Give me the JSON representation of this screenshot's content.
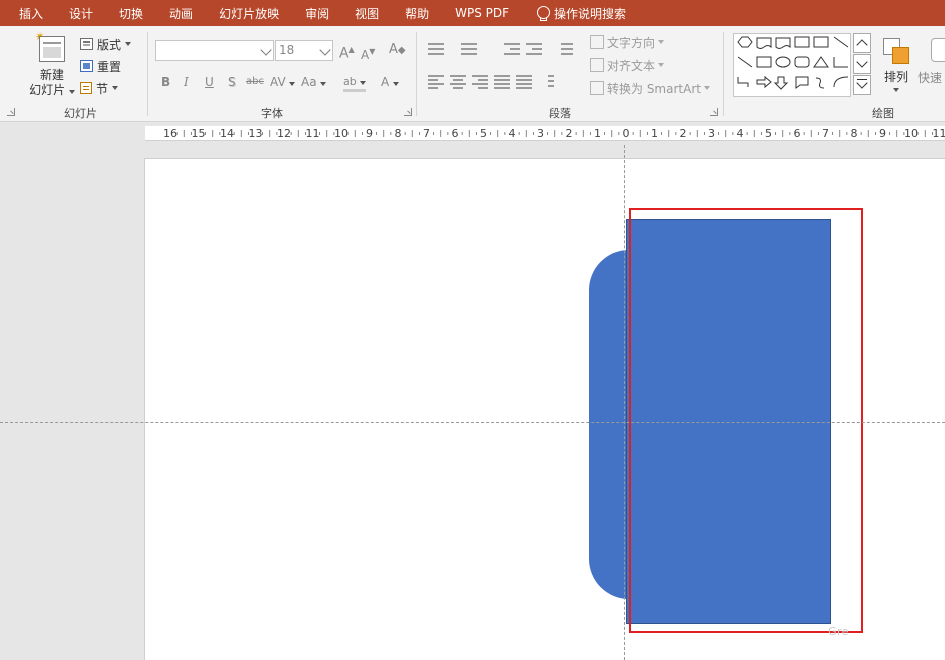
{
  "menu": {
    "tabs": [
      "插入",
      "设计",
      "切换",
      "动画",
      "幻灯片放映",
      "审阅",
      "视图",
      "帮助",
      "WPS PDF"
    ],
    "search_label": "操作说明搜索",
    "bar_color": "#b7472a"
  },
  "ribbon": {
    "slides_group": {
      "label": "幻灯片",
      "new_slide_line1": "新建",
      "new_slide_line2": "幻灯片",
      "layout_label": "版式",
      "reset_label": "重置",
      "section_label": "节"
    },
    "font_group": {
      "label": "字体",
      "font_name": "",
      "font_size": "18",
      "grow_font_glyph": "A",
      "shrink_font_glyph": "A",
      "clear_format_glyph": "A",
      "bold": "B",
      "italic": "I",
      "underline": "U",
      "shadow": "S",
      "strikethrough": "abc",
      "spacing": "AV",
      "change_case": "Aa",
      "highlight": "ab",
      "font_color": "A"
    },
    "paragraph_group": {
      "label": "段落",
      "text_direction_label": "文字方向",
      "align_text_label": "对齐文本",
      "smartart_label": "转换为 SmartArt"
    },
    "drawing_group": {
      "label": "绘图",
      "arrange_label": "排列",
      "quick_styles_label": "快速"
    }
  },
  "ruler": {
    "labels": [
      "16",
      "15",
      "14",
      "13",
      "12",
      "11",
      "10",
      "9",
      "8",
      "7",
      "6",
      "5",
      "4",
      "3",
      "2",
      "1",
      "0",
      "1",
      "2",
      "3",
      "4",
      "5",
      "6",
      "7",
      "8",
      "9",
      "10",
      "11"
    ]
  },
  "slide": {
    "shape_color": "#4472c4",
    "selection_color": "#e02020",
    "watermark": "Gre"
  }
}
